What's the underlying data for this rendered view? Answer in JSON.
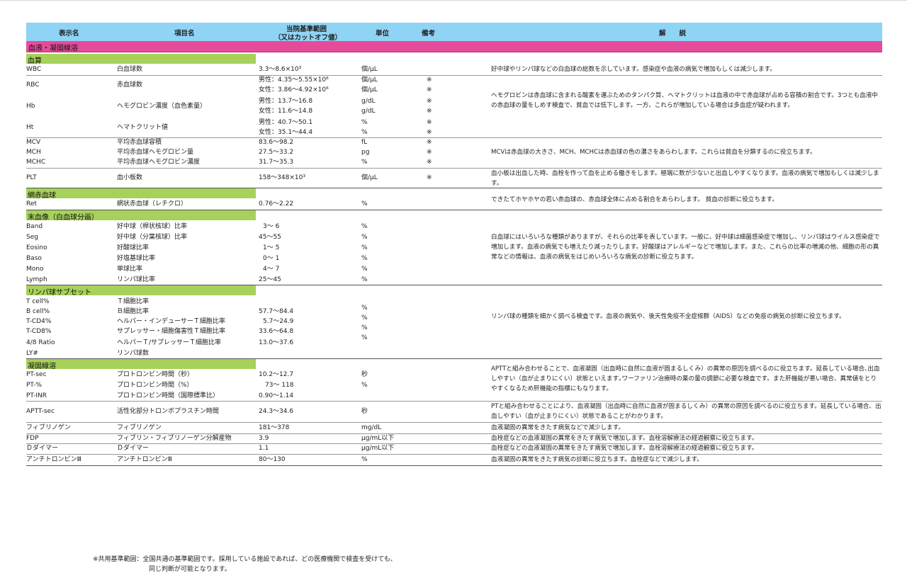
{
  "header": {
    "col_name": "表示名",
    "col_item": "項目名",
    "col_range_1": "当院基準範囲",
    "col_range_2": "（又はカットオフ値）",
    "col_unit": "単位",
    "col_note": "備考",
    "col_expl": "解　　説"
  },
  "section_title": "血液・凝固線溶",
  "groups": {
    "g1": "血算",
    "g2": "網赤血球",
    "g3": "末血像（白血球分画）",
    "g4": "リンパ球サブセット",
    "g5": "凝固線溶"
  },
  "rows": {
    "wbc": {
      "name": "WBC",
      "item": "白血球数",
      "range": "3.3～8.6×10³",
      "unit": "個/μL"
    },
    "rbc": {
      "name": "RBC",
      "item": "赤血球数",
      "range1": "男性：4.35～5.55×10⁶",
      "range2": "女性：3.86～4.92×10⁶",
      "unit1": "個/μL",
      "unit2": "個/μL",
      "note1": "※",
      "note2": "※"
    },
    "hb": {
      "name": "Hb",
      "item": "ヘモグロビン濃度（血色素量）",
      "range1": "男性：13.7～16.8",
      "range2": "女性：11.6～14.8",
      "unit1": "g/dL",
      "unit2": "g/dL",
      "note1": "※",
      "note2": "※"
    },
    "ht": {
      "name": "Ht",
      "item": "ヘマトクリット値",
      "range1": "男性：40.7～50.1",
      "range2": "女性：35.1～44.4",
      "unit1": "%",
      "unit2": "%",
      "note1": "※",
      "note2": "※"
    },
    "mcv": {
      "name": "MCV",
      "item": "平均赤血球容積",
      "range": "83.6～98.2",
      "unit": "fL",
      "note": "※"
    },
    "mch": {
      "name": "MCH",
      "item": "平均赤血球ヘモグロビン量",
      "range": "27.5～33.2",
      "unit": "pg",
      "note": "※"
    },
    "mchc": {
      "name": "MCHC",
      "item": "平均赤血球ヘモグロビン濃度",
      "range": "31.7～35.3",
      "unit": "%",
      "note": "※"
    },
    "plt": {
      "name": "PLT",
      "item": "血小板数",
      "range": "158～348×10³",
      "unit": "個/μL",
      "note": "※"
    },
    "ret": {
      "name": "Ret",
      "item": "網状赤血球（レチクロ）",
      "range": "0.76～2.22",
      "unit": "%"
    },
    "band": {
      "name": "Band",
      "item": "好中球（桿状核球）比率",
      "range": "3～ 6",
      "unit": "%"
    },
    "seg": {
      "name": "Seg",
      "item": "好中球（分葉核球）比率",
      "range": "45～55",
      "unit": "%"
    },
    "eosino": {
      "name": "Eosino",
      "item": "好酸球比率",
      "range": "1～ 5",
      "unit": "%"
    },
    "baso": {
      "name": "Baso",
      "item": "好塩基球比率",
      "range": "0～ 1",
      "unit": "%"
    },
    "mono": {
      "name": "Mono",
      "item": "単球比率",
      "range": "4～ 7",
      "unit": "%"
    },
    "lymph": {
      "name": "Lymph",
      "item": "リンパ球比率",
      "range": "25～45",
      "unit": "%"
    },
    "tcell": {
      "name": "T cell%",
      "item": "Ｔ細胞比率"
    },
    "bcell": {
      "name": "B cell%",
      "item": "Ｂ細胞比率",
      "range": "57.7～84.4"
    },
    "tcd4": {
      "name": "T-CD4%",
      "item": "ヘルパー・インデューサーＴ細胞比率",
      "range": "5.7～24.9"
    },
    "tcd8": {
      "name": "T-CD8%",
      "item": "サプレッサー・細胞傷害性Ｔ細胞比率",
      "range": "33.6～64.8"
    },
    "ratio": {
      "name": "4/8 Ratio",
      "item": "ヘルパーＴ/サプレッサーＴ細胞比率",
      "range": "13.0～37.6"
    },
    "ly": {
      "name": "LY#",
      "item": "リンパ球数"
    },
    "ptsec": {
      "name": "PT-sec",
      "item": "プロトロンビン時間（秒）",
      "range": "10.2～12.7",
      "unit": "秒"
    },
    "ptpct": {
      "name": "PT-%",
      "item": "プロトロンビン時間（%）",
      "range": "73～ 118",
      "unit": "%"
    },
    "ptinr": {
      "name": "PT-INR",
      "item": "プロトロンビン時間（国際標準比）",
      "range": "0.90～1.14"
    },
    "aptt": {
      "name": "APTT-sec",
      "item": "活性化部分トロンボプラスチン時間",
      "range": "24.3～34.6",
      "unit": "秒"
    },
    "fib": {
      "name": "フィブリノゲン",
      "item": "フィブリノゲン",
      "range": "181～378",
      "unit": "mg/dL"
    },
    "fdp": {
      "name": "FDP",
      "item": "フィブリン・フィブリノーゲン分解産物",
      "range": "3.9",
      "unit": "μg/mL以下"
    },
    "dd": {
      "name": "Ｄダイマー",
      "item": "Ｄダイマー",
      "range": "1.1",
      "unit": "μg/mL以下"
    },
    "at3": {
      "name": "アンチトロンビンⅢ",
      "item": "アンチトロンビンⅢ",
      "range": "80～130",
      "unit": "%"
    }
  },
  "lymph_units": [
    "%",
    "%",
    "%",
    "%"
  ],
  "explanations": {
    "wbc": "好中球やリンパ球などの白血球の総数を示しています。感染症や血液の病気で増加もしくは減少します。",
    "rbc_hb_ht": "ヘモグロビンは赤血球に含まれる酸素を運ぶためのタンパク質、ヘマトクリットは血液の中で赤血球が占める容積の割合です。3つとも血液中の赤血球の量をしめす検査で、貧血では低下します。一方、これらが増加している場合は多血症が疑われます。",
    "indices": "MCVは赤血球の大きさ、MCH、MCHCは赤血球の色の濃さをあらわします。これらは貧血を分類するのに役立ちます。",
    "plt": "血小板は出血した時、血栓を作って血を止める働きをします。極端に数が少ないと出血しやすくなります。血液の病気で増加もしくは減少します。",
    "ret": "できたてホヤホヤの若い赤血球の、赤血球全体に占める割合をあらわします。 貧血の診断に役立ちます。",
    "diff": "白血球にはいろいろな種類がありますが、それらの比率を表しています。一般に、好中球は細菌感染症で増加し、リンパ球はウイルス感染症で増加します。血液の病気でも増えたり減ったりします。好酸球はアレルギーなどで増加します。また、これらの比率の増減の他、細胞の形の異常などの情報は、血液の病気をはじめいろいろな病気の診断に役立ちます。",
    "lymph": "リンパ球の種類を細かく調べる検査です。血液の病気や、後天性免疫不全症候群（AIDS）などの免疫の病気の診断に役立ちます。",
    "pt": "APTTと組み合わせることで、血液凝固（出血時に自然に血液が固まるしくみ）の異常の原因を調べるのに役立ちます。延長している場合､出血しやすい（血が止まりにくい）状態といえます｡ワーファリン治療時の薬の量の調節に必要な検査です。また肝機能が悪い場合、異常値をとりやすくなるため肝機能の指標にもなります。",
    "aptt": "PTと組み合わせることにより、血液凝固（出血時に自然に血液が固まるしくみ）の異常の原因を調べるのに役立ちます。延長している場合、出血しやすい（血が止まりにくい）状態であることがわかります。",
    "fib": "血液凝固の異常をきたす病気などで減少します。",
    "fdp": "血栓症などの血液凝固の異常をきたす病気で増加します。血栓溶解療法の経過観察に役立ちます。",
    "dd": "血栓症などの血液凝固の異常をきたす病気で増加します。血栓溶解療法の経過観察に役立ちます。",
    "at3": "血液凝固の異常をきたす病気の診断に役立ちます。血栓症などで減少します。"
  },
  "footnote": {
    "line1": "※共用基準範囲：全国共通の基準範囲です。採用している施設であれば、どの医療機関で検査を受けても、",
    "line2": "同じ判断が可能となります。"
  }
}
